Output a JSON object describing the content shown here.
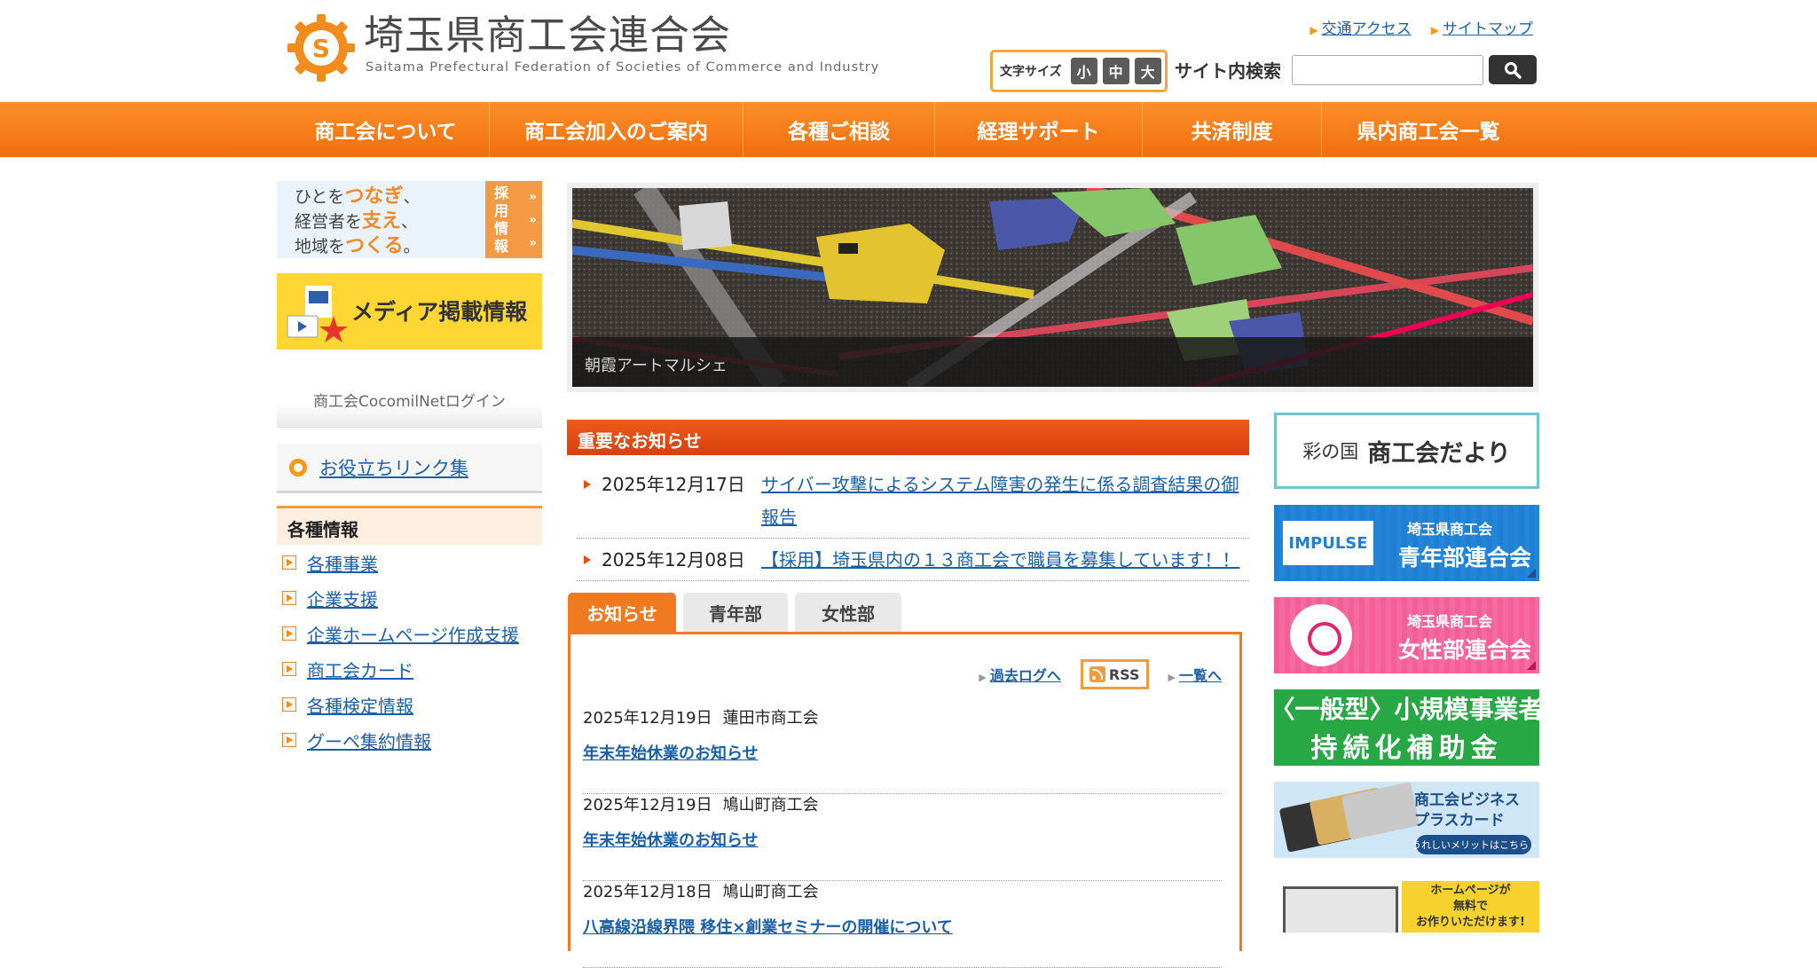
{
  "header": {
    "title": "埼玉県商工会連合会",
    "subtitle": "Saitama Prefectural Federation of Societies of Commerce and Industry",
    "links": [
      "交通アクセス",
      "サイトマップ"
    ],
    "fontsize_label": "文字サイズ",
    "fontsize_buttons": [
      "小",
      "中",
      "大"
    ],
    "search_label": "サイト内検索",
    "search_value": ""
  },
  "nav": {
    "items": [
      "商工会について",
      "商工会加入のご案内",
      "各種ご相談",
      "経理サポート",
      "共済制度",
      "県内商工会一覧"
    ]
  },
  "sidebar": {
    "recruit": {
      "line1_pre": "ひとを",
      "line1_em": "つなぎ",
      "line1_post": "、",
      "line2_pre": "経営者を",
      "line2_em": "支え",
      "line2_post": "、",
      "line3_pre": "地域を",
      "line3_em": "つくる",
      "line3_post": "。",
      "tag": [
        "採",
        "用",
        "情",
        "報"
      ]
    },
    "media_label": "メディア掲載情報",
    "cocomil_label": "商工会CocomilNetログイン",
    "links_label": "お役立ちリンク集",
    "info_heading": "各種情報",
    "info_items": [
      "各種事業",
      "企業支援",
      "企業ホームページ作成支援",
      "商工会カード",
      "各種検定情報",
      "グーペ集約情報"
    ]
  },
  "slide": {
    "caption": "朝霞アートマルシェ"
  },
  "important": {
    "heading": "重要なお知らせ",
    "items": [
      {
        "date": "2025年12月17日",
        "text": "サイバー攻撃によるシステム障害の発生に係る調査結果の御報告"
      },
      {
        "date": "2025年12月08日",
        "text": "【採用】埼玉県内の１３商工会で職員を募集しています！！"
      }
    ]
  },
  "news": {
    "tabs": [
      "お知らせ",
      "青年部",
      "女性部"
    ],
    "past_log": "過去ログへ",
    "rss": "RSS",
    "list_link": "一覧へ",
    "items": [
      {
        "date": "2025年12月19日",
        "org": "蓮田市商工会",
        "title": "年末年始休業のお知らせ"
      },
      {
        "date": "2025年12月19日",
        "org": "鳩山町商工会",
        "title": "年末年始休業のお知らせ"
      },
      {
        "date": "2025年12月18日",
        "org": "鳩山町商工会",
        "title": "八高線沿線界隈 移住×創業セミナーの開催について"
      }
    ]
  },
  "right_banners": {
    "dayori_small": "彩の国",
    "dayori_big": "商工会だより",
    "youth_logo": "IMPULSE",
    "youth_small": "埼玉県商工会",
    "youth_big": "青年部連合会",
    "women_small": "埼玉県商工会",
    "women_big": "女性部連合会",
    "subsidy_line1": "〈一般型〉小規模事業者",
    "subsidy_line2": "持続化補助金",
    "card_line1": "商工会ビジネス",
    "card_line2": "プラスカード",
    "card_pill": "うれしいメリットはこちら ›",
    "hp_line1": "ホームページが",
    "hp_line2": "無料で",
    "hp_line3": "お作りいただけます!"
  },
  "colors": {
    "accent": "#f27a1a",
    "important_red": "#e04a10",
    "link": "#1a5fa8"
  }
}
